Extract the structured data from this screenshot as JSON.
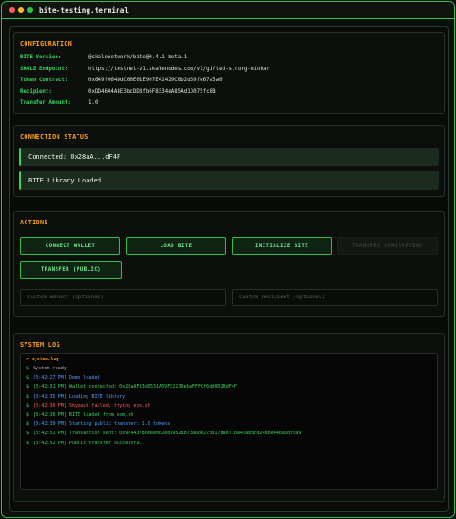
{
  "window": {
    "title": "bite-testing.terminal"
  },
  "config": {
    "title": "CONFIGURATION",
    "rows": [
      {
        "label": "BITE Version:",
        "value": "@skalenetwork/bite@0.4.1-beta.1"
      },
      {
        "label": "SKALE Endpoint:",
        "value": "https://testnet-v1.skalenodes.com/v1/gifted-strong-minkar"
      },
      {
        "label": "Token Contract:",
        "value": "0x649f064bdC00E01E907E42429C6b2d59fe67a5a0"
      },
      {
        "label": "Recipient:",
        "value": "0xDD4604A8E3bcDD8fb6F8334eA85Ad13075fc8B"
      },
      {
        "label": "Transfer Amount:",
        "value": "1.0"
      }
    ]
  },
  "connection": {
    "title": "CONNECTION STATUS",
    "status1": "Connected: 0x28aA...dF4F",
    "status2": "BITE Library Loaded"
  },
  "actions": {
    "title": "ACTIONS",
    "connect_wallet": "CONNECT WALLET",
    "load_bite": "LOAD BITE",
    "initialize_bite": "INITIALIZE BITE",
    "transfer_encrypted": "TRANSFER (ENCRYPTED)",
    "transfer_public": "TRANSFER (PUBLIC)",
    "amount_placeholder": "Custom amount (optional)",
    "recipient_placeholder": "Custom recipient (optional)"
  },
  "syslog": {
    "title": "SYSTEM LOG",
    "header": "> system.log",
    "prompt": "$",
    "colors": {
      "default": "#a9b5a9",
      "info": "#4f9dff",
      "success": "#3ad25e",
      "error": "#ff5a5a"
    },
    "lines": [
      {
        "ts": "",
        "msg": "System ready",
        "kind": "default"
      },
      {
        "ts": "[3:42:27 PM]",
        "msg": "Demo loaded",
        "kind": "info"
      },
      {
        "ts": "[3:42:31 PM]",
        "msg": "Wallet connected: 0x28aAFd3d0531A09FE2230ebaFFFCf6dd0D28dF4F",
        "kind": "success"
      },
      {
        "ts": "[3:42:35 PM]",
        "msg": "Loading BITE library",
        "kind": "info"
      },
      {
        "ts": "[3:42:36 PM]",
        "msg": "Skypack failed, trying esm.sh",
        "kind": "error"
      },
      {
        "ts": "[3:42:36 PM]",
        "msg": "BITE loaded from esm.sh",
        "kind": "success"
      },
      {
        "ts": "[3:42:39 PM]",
        "msg": "Starting public transfer: 1.0 tokens",
        "kind": "info"
      },
      {
        "ts": "[3:42:51 PM]",
        "msg": "Transaction sent: 0x9d443786beebb2eb3952dd73a6b02758178ad71ba43a85fd248be64ba5bfba9",
        "kind": "success"
      },
      {
        "ts": "[3:42:52 PM]",
        "msg": "Public transfer successful",
        "kind": "success"
      }
    ]
  }
}
